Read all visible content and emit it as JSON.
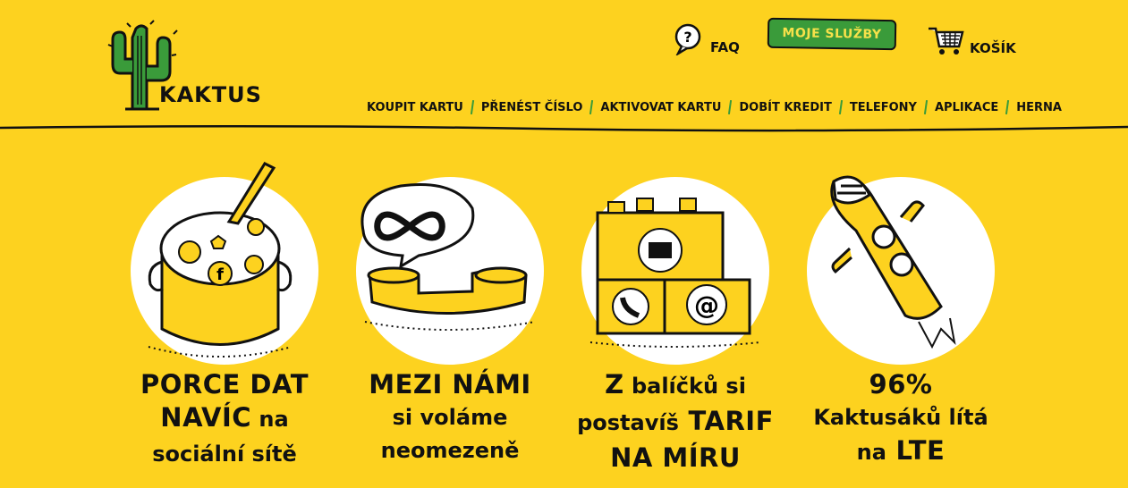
{
  "header": {
    "logo_text": "KAKTUS",
    "faq_label": "FAQ",
    "moje_sluzby_label": "MOJE SLUŽBY",
    "cart_label": "KOŠÍK"
  },
  "nav": {
    "items": [
      "KOUPIT KARTU",
      "PŘENÉST ČÍSLO",
      "AKTIVOVAT KARTU",
      "DOBÍT KREDIT",
      "TELEFONY",
      "APLIKACE",
      "HERNA"
    ]
  },
  "features": [
    {
      "line1": "PORCE DAT",
      "line2a": "NAVÍC",
      "line2b": " na",
      "line3": "sociální sítě"
    },
    {
      "line1": "MEZI NÁMI",
      "line2": "si voláme",
      "line3": "neomezeně"
    },
    {
      "line1a": "Z",
      "line1b": " balíčků si",
      "line2a": "postavíš",
      "line2b": " TARIF",
      "line3": "NA MÍRU"
    },
    {
      "line1": "96%",
      "line2": "Kaktusáků lítá",
      "line3a": "na",
      "line3b": " LTE"
    }
  ],
  "colors": {
    "background": "#FDD21F",
    "green": "#3A9B3A",
    "text": "#111111"
  }
}
